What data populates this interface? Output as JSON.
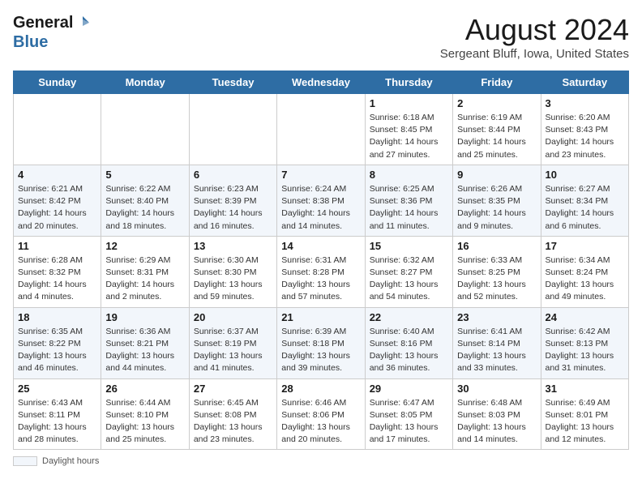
{
  "logo": {
    "line1": "General",
    "line2": "Blue"
  },
  "title": "August 2024",
  "location": "Sergeant Bluff, Iowa, United States",
  "days_of_week": [
    "Sunday",
    "Monday",
    "Tuesday",
    "Wednesday",
    "Thursday",
    "Friday",
    "Saturday"
  ],
  "footer": {
    "label": "Daylight hours"
  },
  "weeks": [
    [
      {
        "day": "",
        "info": ""
      },
      {
        "day": "",
        "info": ""
      },
      {
        "day": "",
        "info": ""
      },
      {
        "day": "",
        "info": ""
      },
      {
        "day": "1",
        "info": "Sunrise: 6:18 AM\nSunset: 8:45 PM\nDaylight: 14 hours\nand 27 minutes."
      },
      {
        "day": "2",
        "info": "Sunrise: 6:19 AM\nSunset: 8:44 PM\nDaylight: 14 hours\nand 25 minutes."
      },
      {
        "day": "3",
        "info": "Sunrise: 6:20 AM\nSunset: 8:43 PM\nDaylight: 14 hours\nand 23 minutes."
      }
    ],
    [
      {
        "day": "4",
        "info": "Sunrise: 6:21 AM\nSunset: 8:42 PM\nDaylight: 14 hours\nand 20 minutes."
      },
      {
        "day": "5",
        "info": "Sunrise: 6:22 AM\nSunset: 8:40 PM\nDaylight: 14 hours\nand 18 minutes."
      },
      {
        "day": "6",
        "info": "Sunrise: 6:23 AM\nSunset: 8:39 PM\nDaylight: 14 hours\nand 16 minutes."
      },
      {
        "day": "7",
        "info": "Sunrise: 6:24 AM\nSunset: 8:38 PM\nDaylight: 14 hours\nand 14 minutes."
      },
      {
        "day": "8",
        "info": "Sunrise: 6:25 AM\nSunset: 8:36 PM\nDaylight: 14 hours\nand 11 minutes."
      },
      {
        "day": "9",
        "info": "Sunrise: 6:26 AM\nSunset: 8:35 PM\nDaylight: 14 hours\nand 9 minutes."
      },
      {
        "day": "10",
        "info": "Sunrise: 6:27 AM\nSunset: 8:34 PM\nDaylight: 14 hours\nand 6 minutes."
      }
    ],
    [
      {
        "day": "11",
        "info": "Sunrise: 6:28 AM\nSunset: 8:32 PM\nDaylight: 14 hours\nand 4 minutes."
      },
      {
        "day": "12",
        "info": "Sunrise: 6:29 AM\nSunset: 8:31 PM\nDaylight: 14 hours\nand 2 minutes."
      },
      {
        "day": "13",
        "info": "Sunrise: 6:30 AM\nSunset: 8:30 PM\nDaylight: 13 hours\nand 59 minutes."
      },
      {
        "day": "14",
        "info": "Sunrise: 6:31 AM\nSunset: 8:28 PM\nDaylight: 13 hours\nand 57 minutes."
      },
      {
        "day": "15",
        "info": "Sunrise: 6:32 AM\nSunset: 8:27 PM\nDaylight: 13 hours\nand 54 minutes."
      },
      {
        "day": "16",
        "info": "Sunrise: 6:33 AM\nSunset: 8:25 PM\nDaylight: 13 hours\nand 52 minutes."
      },
      {
        "day": "17",
        "info": "Sunrise: 6:34 AM\nSunset: 8:24 PM\nDaylight: 13 hours\nand 49 minutes."
      }
    ],
    [
      {
        "day": "18",
        "info": "Sunrise: 6:35 AM\nSunset: 8:22 PM\nDaylight: 13 hours\nand 46 minutes."
      },
      {
        "day": "19",
        "info": "Sunrise: 6:36 AM\nSunset: 8:21 PM\nDaylight: 13 hours\nand 44 minutes."
      },
      {
        "day": "20",
        "info": "Sunrise: 6:37 AM\nSunset: 8:19 PM\nDaylight: 13 hours\nand 41 minutes."
      },
      {
        "day": "21",
        "info": "Sunrise: 6:39 AM\nSunset: 8:18 PM\nDaylight: 13 hours\nand 39 minutes."
      },
      {
        "day": "22",
        "info": "Sunrise: 6:40 AM\nSunset: 8:16 PM\nDaylight: 13 hours\nand 36 minutes."
      },
      {
        "day": "23",
        "info": "Sunrise: 6:41 AM\nSunset: 8:14 PM\nDaylight: 13 hours\nand 33 minutes."
      },
      {
        "day": "24",
        "info": "Sunrise: 6:42 AM\nSunset: 8:13 PM\nDaylight: 13 hours\nand 31 minutes."
      }
    ],
    [
      {
        "day": "25",
        "info": "Sunrise: 6:43 AM\nSunset: 8:11 PM\nDaylight: 13 hours\nand 28 minutes."
      },
      {
        "day": "26",
        "info": "Sunrise: 6:44 AM\nSunset: 8:10 PM\nDaylight: 13 hours\nand 25 minutes."
      },
      {
        "day": "27",
        "info": "Sunrise: 6:45 AM\nSunset: 8:08 PM\nDaylight: 13 hours\nand 23 minutes."
      },
      {
        "day": "28",
        "info": "Sunrise: 6:46 AM\nSunset: 8:06 PM\nDaylight: 13 hours\nand 20 minutes."
      },
      {
        "day": "29",
        "info": "Sunrise: 6:47 AM\nSunset: 8:05 PM\nDaylight: 13 hours\nand 17 minutes."
      },
      {
        "day": "30",
        "info": "Sunrise: 6:48 AM\nSunset: 8:03 PM\nDaylight: 13 hours\nand 14 minutes."
      },
      {
        "day": "31",
        "info": "Sunrise: 6:49 AM\nSunset: 8:01 PM\nDaylight: 13 hours\nand 12 minutes."
      }
    ]
  ]
}
